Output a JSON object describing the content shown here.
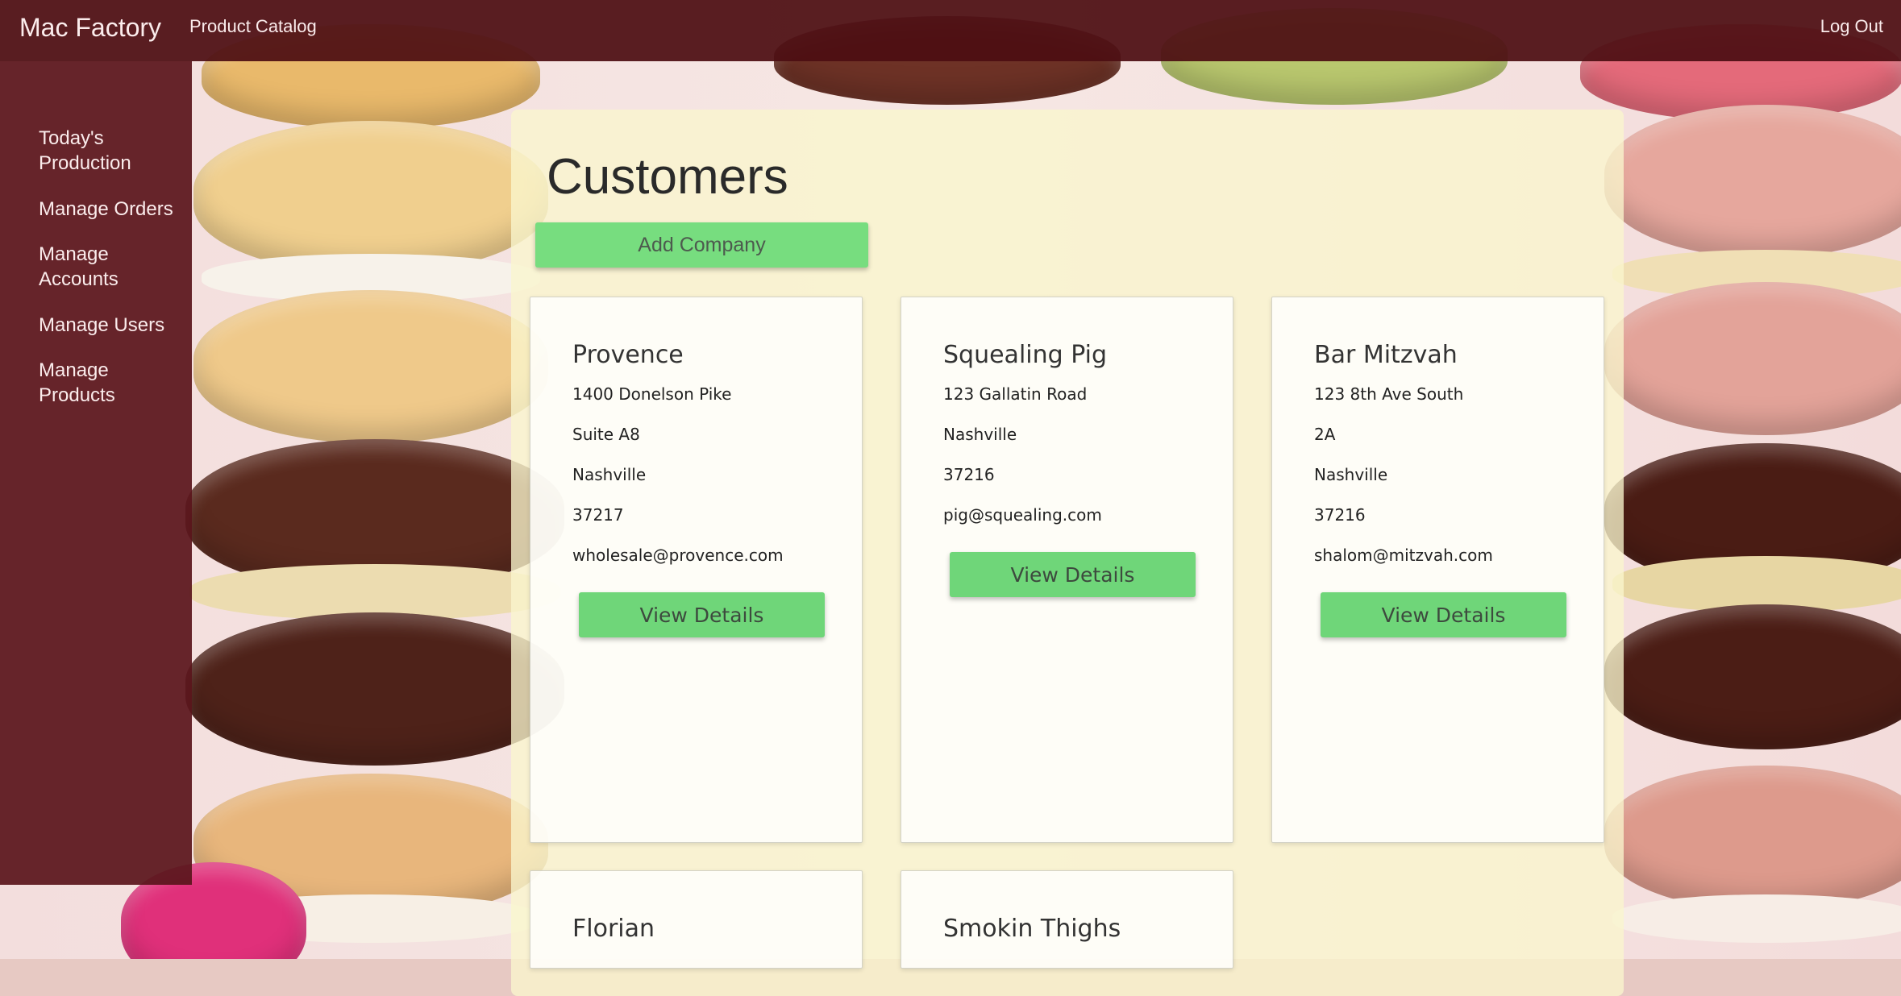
{
  "navbar": {
    "brand": "Mac Factory",
    "catalog_link": "Product Catalog",
    "logout": "Log Out"
  },
  "sidebar": {
    "items": [
      {
        "label": "Today's Production"
      },
      {
        "label": "Manage Orders"
      },
      {
        "label": "Manage Accounts"
      },
      {
        "label": "Manage Users"
      },
      {
        "label": "Manage Products"
      }
    ]
  },
  "main": {
    "title": "Customers",
    "add_company_label": "Add Company",
    "customers": [
      {
        "name": "Provence",
        "lines": [
          "1400 Donelson Pike",
          "Suite A8",
          "Nashville",
          "37217",
          "wholesale@provence.com"
        ],
        "button": "View Details"
      },
      {
        "name": "Squealing Pig",
        "lines": [
          "123 Gallatin Road",
          "Nashville",
          "37216",
          "pig@squealing.com"
        ],
        "button": "View Details"
      },
      {
        "name": "Bar Mitzvah",
        "lines": [
          "123 8th Ave South",
          "2A",
          "Nashville",
          "37216",
          "shalom@mitzvah.com"
        ],
        "button": "View Details"
      },
      {
        "name": "Florian",
        "lines": [],
        "button": ""
      },
      {
        "name": "Smokin Thighs",
        "lines": [],
        "button": ""
      }
    ]
  },
  "colors": {
    "navbar": "#4c0e12",
    "sidebar": "#5a161c",
    "panel": "#faf6cd",
    "button_green": "#77dd7f"
  }
}
